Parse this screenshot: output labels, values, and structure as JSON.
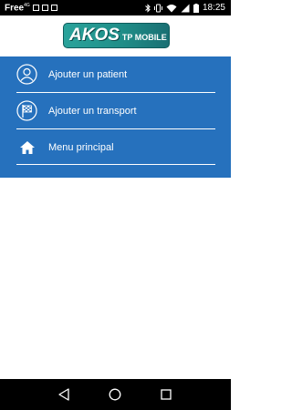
{
  "status_bar": {
    "carrier": "Free",
    "carrier_sup": "4G",
    "time": "18:25"
  },
  "header": {
    "logo_main": "AKOS",
    "logo_sub": "TP MOBILE"
  },
  "menu": {
    "background": "#2671bd",
    "items": [
      {
        "label": "Ajouter un patient",
        "icon": "person-icon"
      },
      {
        "label": "Ajouter un transport",
        "icon": "checkered-flag-icon"
      },
      {
        "label": "Menu principal",
        "icon": "home-icon"
      }
    ]
  },
  "nav_bar": {
    "buttons": [
      "back-icon",
      "home-circle-icon",
      "recents-icon"
    ]
  }
}
